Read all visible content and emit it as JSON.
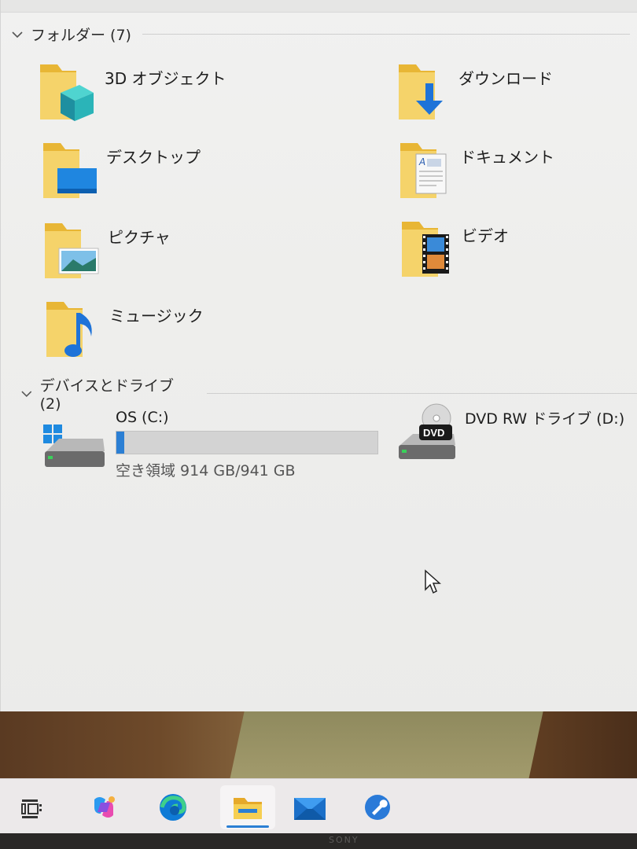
{
  "folders_group": {
    "title": "フォルダー (7)",
    "items": [
      {
        "label": "3D オブジェクト",
        "icon": "3d-objects-folder-icon"
      },
      {
        "label": "ダウンロード",
        "icon": "downloads-folder-icon"
      },
      {
        "label": "デスクトップ",
        "icon": "desktop-folder-icon"
      },
      {
        "label": "ドキュメント",
        "icon": "documents-folder-icon"
      },
      {
        "label": "ピクチャ",
        "icon": "pictures-folder-icon"
      },
      {
        "label": "ビデオ",
        "icon": "videos-folder-icon"
      },
      {
        "label": "ミュージック",
        "icon": "music-folder-icon"
      }
    ]
  },
  "drives_group": {
    "title": "デバイスとドライブ (2)",
    "drives": [
      {
        "name": "OS (C:)",
        "free_text": "空き領域 914 GB/941 GB",
        "used_fraction": 0.029,
        "icon": "windows-drive-icon"
      },
      {
        "name": "DVD RW ドライブ (D:)",
        "icon": "dvd-drive-icon",
        "badge": "DVD"
      }
    ]
  },
  "taskbar": {
    "items": [
      "task-view-icon",
      "copilot-icon",
      "edge-icon",
      "file-explorer-icon",
      "mail-icon",
      "settings-tool-icon"
    ],
    "active": "file-explorer-icon"
  },
  "bezel_brand": "SONY",
  "colors": {
    "accent": "#2b7fd4",
    "folder": "#f2c94c"
  }
}
